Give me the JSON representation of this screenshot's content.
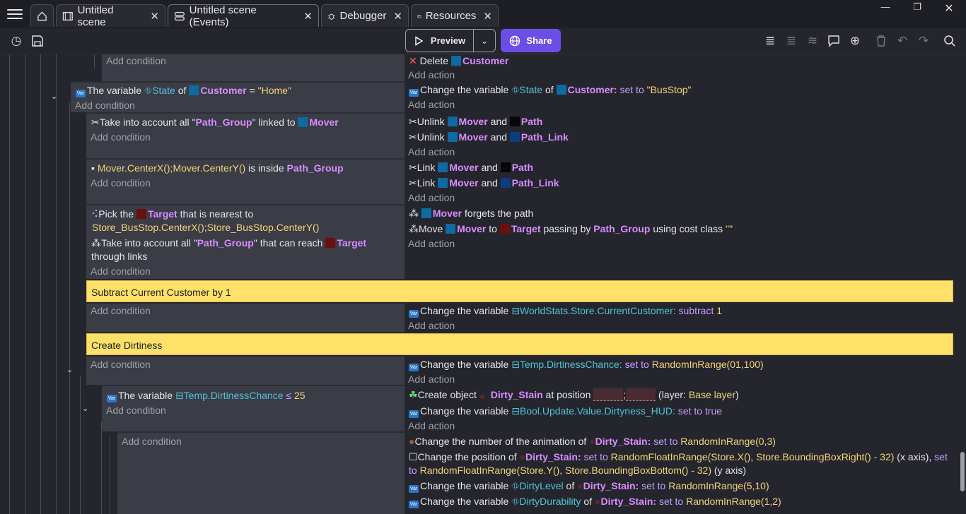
{
  "tabs": [
    {
      "label": "Untitled scene",
      "icon": "film-icon"
    },
    {
      "label": "Untitled scene (Events)",
      "icon": "events-list-icon"
    },
    {
      "label": "Debugger",
      "icon": "bug-icon"
    },
    {
      "label": "Resources",
      "icon": "folder-icon"
    }
  ],
  "toolbar": {
    "preview_label": "Preview",
    "share_label": "Share"
  },
  "common": {
    "add_condition": "Add condition",
    "add_action": "Add action"
  },
  "ev0": {
    "a_delete": "Delete",
    "a_obj": "Customer"
  },
  "ev1": {
    "c_pre": "The variable",
    "c_var": "State",
    "c_of": "of",
    "c_obj": "Customer",
    "c_eq": "=",
    "c_val": "\"Home\"",
    "a_pre": "Change the variable",
    "a_var": "State",
    "a_of": "of",
    "a_obj": "Customer:",
    "a_op": "set to",
    "a_val": "\"BusStop\""
  },
  "ev2": {
    "c_pre": "Take into account all \"",
    "c_grp": "Path_Group",
    "c_mid": "\" linked to",
    "c_obj": "Mover",
    "a1_pre": "Unlink",
    "a1_obj": "Mover",
    "a1_and": "and",
    "a1_obj2": "Path",
    "a2_pre": "Unlink",
    "a2_obj": "Mover",
    "a2_and": "and",
    "a2_obj2": "Path_Link"
  },
  "ev3": {
    "c_expr": "Mover.CenterX();Mover.CenterY()",
    "c_mid": "is inside",
    "c_grp": "Path_Group",
    "a1_pre": "Link",
    "a1_obj": "Mover",
    "a1_and": "and",
    "a1_obj2": "Path",
    "a2_pre": "Link",
    "a2_obj": "Mover",
    "a2_and": "and",
    "a2_obj2": "Path_Link"
  },
  "ev4": {
    "c1_pre": "Pick the",
    "c1_obj": "Target",
    "c1_mid": "that is nearest to",
    "c1_expr": "Store_BusStop.CenterX();Store_BusStop.CenterY()",
    "c2_pre": "Take into account all \"",
    "c2_grp": "Path_Group",
    "c2_mid": "\" that can reach",
    "c2_obj": "Target",
    "c2_end": "through links",
    "a1_obj": "Mover",
    "a1_txt": "forgets the path",
    "a2_pre": "Move",
    "a2_obj": "Mover",
    "a2_to": "to",
    "a2_obj2": "Target",
    "a2_mid": "passing by",
    "a2_grp": "Path_Group",
    "a2_cls": "using cost class",
    "a2_val": "\"\""
  },
  "comment1": "Subtract Current Customer by 1",
  "ev5": {
    "a_pre": "Change the variable",
    "a_var": "WorldStats.Store.CurrentCustomer:",
    "a_op": "subtract",
    "a_val": "1"
  },
  "comment2": "Create Dirtiness",
  "ev6": {
    "a_pre": "Change the variable",
    "a_var": "Temp.DirtinessChance:",
    "a_op": "set to",
    "a_val": "RandomInRange(01,100)"
  },
  "ev7": {
    "c_pre": "The variable",
    "c_var": "Temp.DirtinessChance",
    "c_op": "≤",
    "c_val": "25",
    "a1_pre": "Create object",
    "a1_obj": "Dirty_Stain",
    "a1_mid": "at position",
    "a1_sep": ";",
    "a1_layer_pre": "(layer:",
    "a1_layer": "Base layer",
    "a1_layer_end": ")",
    "a2_pre": "Change the variable",
    "a2_var": "Bool.Update.Value.Dirtyness_HUD:",
    "a2_op": "set to true"
  },
  "ev8": {
    "a1_pre": "Change the number of the animation of",
    "a1_obj": "Dirty_Stain:",
    "a1_op": "set to",
    "a1_val": "RandomInRange(0,3)",
    "a2_pre": "Change the position of",
    "a2_obj": "Dirty_Stain:",
    "a2_op": "set to",
    "a2_val": "RandomFloatInRange(Store.X(), Store.BoundingBoxRight() - 32)",
    "a2_ax": "(x axis),",
    "a2_op2": "set",
    "a2_l2_op": "to",
    "a2_l2_val": "RandomFloatInRange(Store.Y(), Store.BoundingBoxBottom() - 32)",
    "a2_l2_ax": "(y axis)",
    "a3_pre": "Change the variable",
    "a3_var": "DirtyLevel",
    "a3_of": "of",
    "a3_obj": "Dirty_Stain:",
    "a3_op": "set to",
    "a3_val": "RandomInRange(5,10)",
    "a4_pre": "Change the variable",
    "a4_var": "DirtyDurability",
    "a4_of": "of",
    "a4_obj": "Dirty_Stain:",
    "a4_op": "set to",
    "a4_val": "RandomInRange(1,2)"
  }
}
